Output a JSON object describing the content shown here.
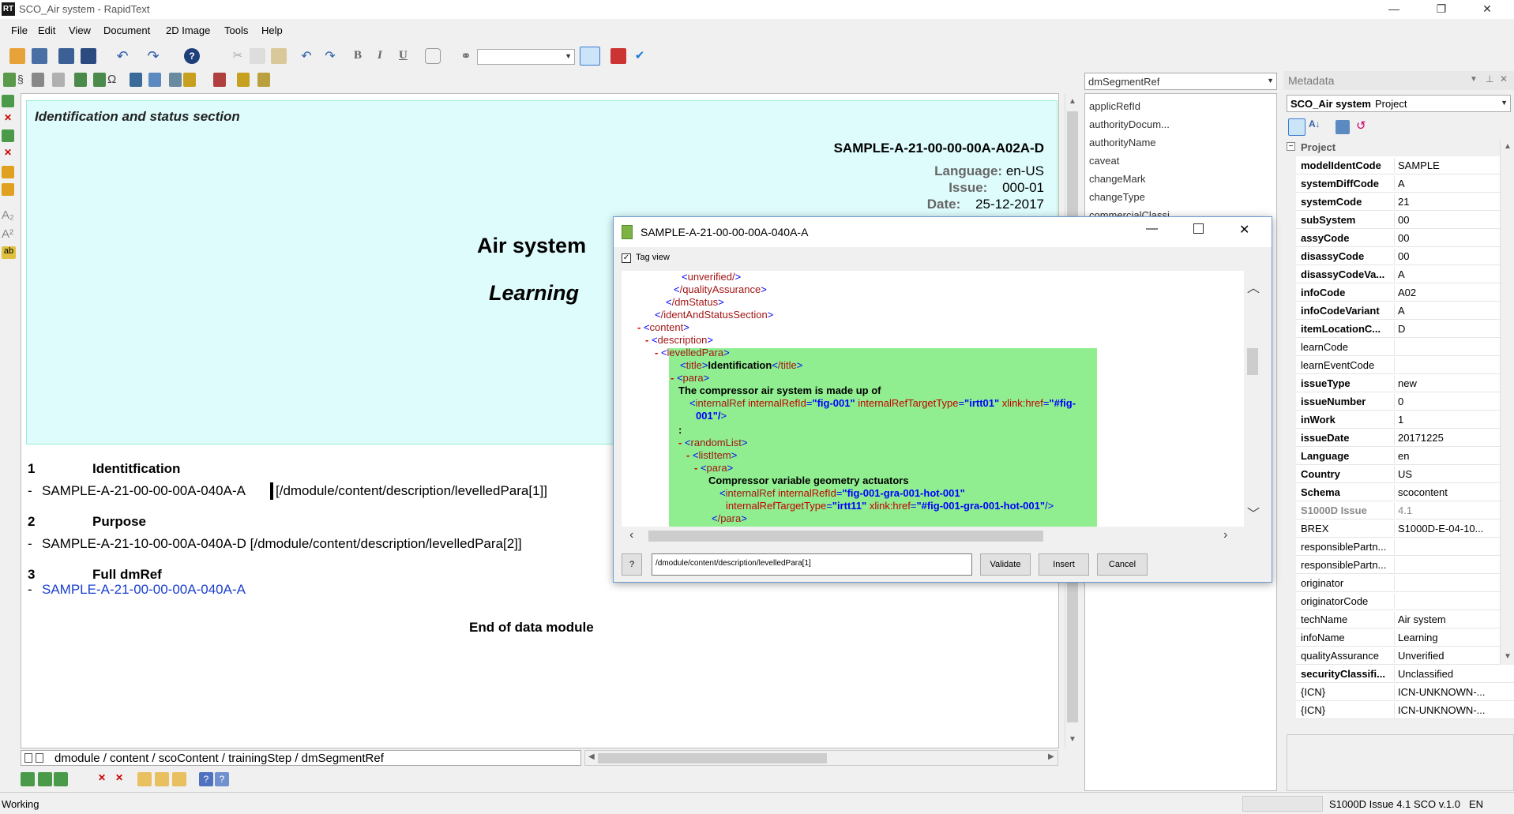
{
  "window": {
    "title": "SCO_Air system - RapidText",
    "app_icon": "RT",
    "minimize": "—",
    "restore": "❐",
    "close": "✕"
  },
  "menu": [
    "File",
    "Edit",
    "View",
    "Document",
    "2D Image",
    "Tools",
    "Help"
  ],
  "ident": {
    "section_title": "Identification and status section",
    "dmc": "SAMPLE-A-21-00-00-00A-A02A-D",
    "language_label": "Language:",
    "language": "en-US",
    "issue_label": "Issue:",
    "issue": "000-01",
    "date_label": "Date:",
    "date": "25-12-2017",
    "tech_name": "Air system",
    "info_name": "Learning"
  },
  "content": {
    "items": [
      {
        "num": "1",
        "title": "Identitfication",
        "ref": "SAMPLE-A-21-00-00-00A-040A-A",
        "path": "[/dmodule/content/description/levelledPara[1]]"
      },
      {
        "num": "2",
        "title": "Purpose",
        "ref": "SAMPLE-A-21-10-00-00A-040A-D [/dmodule/content/description/levelledPara[2]]"
      },
      {
        "num": "3",
        "title": "Full dmRef",
        "ref": "SAMPLE-A-21-00-00-00A-040A-A"
      }
    ],
    "bullet": "-",
    "end": "End of data module"
  },
  "breadcrumb": "dmodule / content / scoContent / trainingStep / dmSegmentRef",
  "attr_panel": {
    "selector": "dmSegmentRef",
    "attributes": [
      "applicRefId",
      "authorityDocum...",
      "authorityName",
      "caveat",
      "changeMark",
      "changeType",
      "commercialClassi..."
    ]
  },
  "metadata": {
    "header": "Metadata",
    "object_name": "SCO_Air system",
    "object_type": "Project",
    "category": "Project",
    "rows": [
      {
        "k": "modelIdentCode",
        "v": "SAMPLE",
        "bold": true
      },
      {
        "k": "systemDiffCode",
        "v": "A",
        "bold": true
      },
      {
        "k": "systemCode",
        "v": "21",
        "bold": true
      },
      {
        "k": "subSystem",
        "v": "00",
        "bold": true
      },
      {
        "k": "assyCode",
        "v": "00",
        "bold": true
      },
      {
        "k": "disassyCode",
        "v": "00",
        "bold": true
      },
      {
        "k": "disassyCodeVa...",
        "v": "A",
        "bold": true
      },
      {
        "k": "infoCode",
        "v": "A02",
        "bold": true
      },
      {
        "k": "infoCodeVariant",
        "v": "A",
        "bold": true
      },
      {
        "k": "itemLocationC...",
        "v": "D",
        "bold": true
      },
      {
        "k": "learnCode",
        "v": "",
        "bold": false
      },
      {
        "k": "learnEventCode",
        "v": "",
        "bold": false
      },
      {
        "k": "issueType",
        "v": "new",
        "bold": true
      },
      {
        "k": "issueNumber",
        "v": "0",
        "bold": true
      },
      {
        "k": "inWork",
        "v": "1",
        "bold": true
      },
      {
        "k": "issueDate",
        "v": "20171225",
        "bold": true
      },
      {
        "k": "Language",
        "v": "en",
        "bold": true
      },
      {
        "k": "Country",
        "v": "US",
        "bold": true
      },
      {
        "k": "Schema",
        "v": "scocontent",
        "bold": true
      },
      {
        "k": "S1000D Issue",
        "v": "4.1",
        "bold": true,
        "grey": true
      },
      {
        "k": "BREX",
        "v": "S1000D-E-04-10...",
        "bold": false
      },
      {
        "k": "responsiblePartn...",
        "v": "",
        "bold": false
      },
      {
        "k": "responsiblePartn...",
        "v": "",
        "bold": false
      },
      {
        "k": "originator",
        "v": "",
        "bold": false
      },
      {
        "k": "originatorCode",
        "v": "",
        "bold": false
      },
      {
        "k": "techName",
        "v": "Air system",
        "bold": false
      },
      {
        "k": "infoName",
        "v": "Learning",
        "bold": false
      },
      {
        "k": "qualityAssurance",
        "v": "Unverified",
        "bold": false
      },
      {
        "k": "securityClassifi...",
        "v": "Unclassified",
        "bold": true
      },
      {
        "k": "{ICN}",
        "v": "ICN-UNKNOWN-...",
        "bold": false
      },
      {
        "k": "{ICN}",
        "v": "ICN-UNKNOWN-...",
        "bold": false
      }
    ]
  },
  "dialog": {
    "title": "SAMPLE-A-21-00-00-00A-040A-A",
    "tag_view_label": "Tag view",
    "tag_view_checked": true,
    "path_value": "/dmodule/content/description/levelledPara[1]",
    "help_label": "?",
    "validate_label": "Validate",
    "insert_label": "Insert",
    "cancel_label": "Cancel",
    "xml": {
      "l1": "unverified/",
      "l2": "/qualityAssurance",
      "l3": "/dmStatus",
      "l4": "/identAndStatusSection",
      "l5": "content",
      "l6": "description",
      "l7": "levelledPara",
      "l8_tag": "title",
      "l8_text": "Identification",
      "l8_close": "/title",
      "l9": "para",
      "l10": "The compressor air system is made up of",
      "l11_tag": "internalRef",
      "l11_a1": "internalRefId",
      "l11_v1": "\"fig-001\"",
      "l11_a2": "internalRefTargetType",
      "l11_v2": "\"irtt01\"",
      "l11_a3": "xlink:href",
      "l11_v3": "\"#fig-",
      "l12": "001\"/",
      "l13": ":",
      "l14": "randomList",
      "l15": "listItem",
      "l16": "para",
      "l17": "Compressor variable geometry actuators",
      "l18_tag": "internalRef",
      "l18_a1": "internalRefId",
      "l18_v1": "\"fig-001-gra-001-hot-001\"",
      "l19_a1": "internalRefTargetType",
      "l19_v1": "\"irtt11\"",
      "l19_a2": "xlink:href",
      "l19_v2": "\"#fig-001-gra-001-hot-001\"",
      "l20": "/para"
    }
  },
  "status": {
    "left": "Working",
    "right": "S1000D Issue 4.1 SCO v.1.0",
    "lang": "EN"
  }
}
